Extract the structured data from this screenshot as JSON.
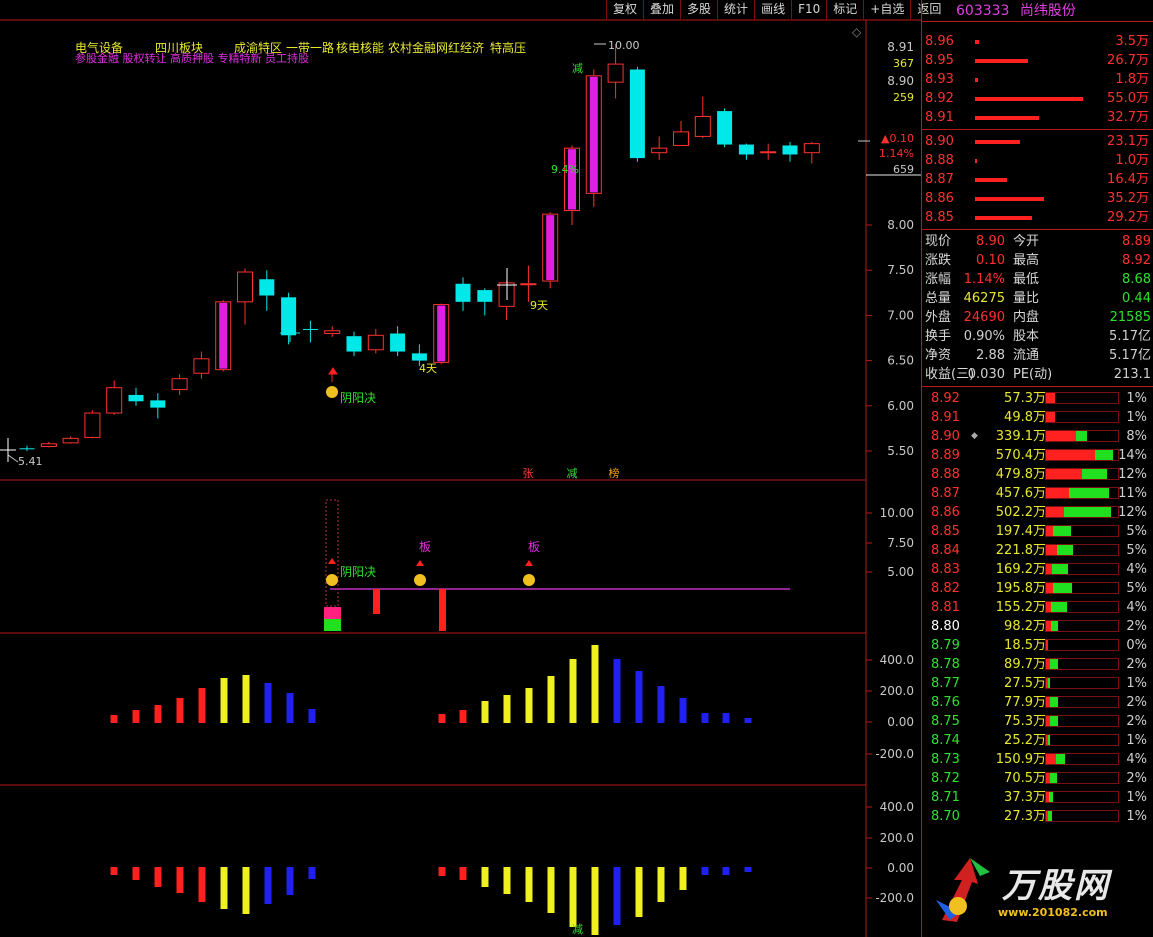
{
  "toolbar": {
    "buttons": [
      "复权",
      "叠加",
      "多股",
      "统计",
      "画线",
      "F10",
      "标记",
      "+自选",
      "返回"
    ]
  },
  "stock": {
    "code": "603333",
    "name": "尚纬股份"
  },
  "main_chart": {
    "concepts_line1": [
      "电气设备",
      "四川板块",
      "成渝特区",
      "一带一路",
      "核电核能",
      "农村金融",
      "网红经济",
      "特高压"
    ],
    "concepts_line2": "参股金融 股权转让 高质押股 专精特新 员工持股",
    "high_label": "10.00",
    "low_label": "5.41",
    "y_ticks": [
      "8.00",
      "7.50",
      "7.00",
      "6.50",
      "6.00",
      "5.50"
    ],
    "right_info": {
      "p1": "8.91",
      "v1": "367",
      "p2": "8.90",
      "v2": "259",
      "chg": "▲0.10",
      "pct": "1.14%",
      "vol": "659"
    },
    "annotations": {
      "jian": "减",
      "pct94": "9.4%",
      "tian9": "9天",
      "tian4": "4天",
      "yinyang": "阴阳决"
    },
    "markers": [
      "张",
      "减",
      "榜"
    ]
  },
  "panel2": {
    "y_ticks": [
      "10.00",
      "7.50",
      "5.00"
    ],
    "ban": "板",
    "yinyang": "阴阳决"
  },
  "panel3": {
    "y_ticks": [
      "400.0",
      "200.0",
      "0.00",
      "-200.0"
    ]
  },
  "panel4": {
    "y_ticks": [
      "400.0",
      "200.0",
      "0.00",
      "-200.0"
    ],
    "jian": "减"
  },
  "order_book": {
    "asks": [
      {
        "price": "8.96",
        "vol": "3.5万",
        "bar": 0.04
      },
      {
        "price": "8.95",
        "vol": "26.7万",
        "bar": 0.49
      },
      {
        "price": "8.93",
        "vol": "1.8万",
        "bar": 0.03
      },
      {
        "price": "8.92",
        "vol": "55.0万",
        "bar": 1.0
      },
      {
        "price": "8.91",
        "vol": "32.7万",
        "bar": 0.59
      }
    ],
    "bids": [
      {
        "price": "8.90",
        "vol": "23.1万",
        "bar": 0.42
      },
      {
        "price": "8.88",
        "vol": "1.0万",
        "bar": 0.02
      },
      {
        "price": "8.87",
        "vol": "16.4万",
        "bar": 0.3
      },
      {
        "price": "8.86",
        "vol": "35.2万",
        "bar": 0.64
      },
      {
        "price": "8.85",
        "vol": "29.2万",
        "bar": 0.53
      }
    ]
  },
  "stats": [
    {
      "l1": "现价",
      "v1": "8.90",
      "c1": "#ff3030",
      "l2": "今开",
      "v2": "8.89",
      "c2": "#ff3030"
    },
    {
      "l1": "涨跌",
      "v1": "0.10",
      "c1": "#ff3030",
      "l2": "最高",
      "v2": "8.92",
      "c2": "#ff3030"
    },
    {
      "l1": "涨幅",
      "v1": "1.14%",
      "c1": "#ff3030",
      "l2": "最低",
      "v2": "8.68",
      "c2": "#30e030"
    },
    {
      "l1": "总量",
      "v1": "46275",
      "c1": "#e8e830",
      "l2": "量比",
      "v2": "0.44",
      "c2": "#30e030"
    },
    {
      "l1": "外盘",
      "v1": "24690",
      "c1": "#ff3030",
      "l2": "内盘",
      "v2": "21585",
      "c2": "#30e030"
    },
    {
      "l1": "换手",
      "v1": "0.90%",
      "c1": "#d0d0d0",
      "l2": "股本",
      "v2": "5.17亿",
      "c2": "#d0d0d0"
    },
    {
      "l1": "净资",
      "v1": "2.88",
      "c1": "#d0d0d0",
      "l2": "流通",
      "v2": "5.17亿",
      "c2": "#d0d0d0"
    },
    {
      "l1": "收益(三)",
      "v1": "0.030",
      "c1": "#d0d0d0",
      "l2": "PE(动)",
      "v2": "213.1",
      "c2": "#d0d0d0"
    }
  ],
  "volume_by_price": [
    {
      "price": "8.92",
      "vol": "57.3万",
      "pct": "1%",
      "r": 0.13,
      "g": 0
    },
    {
      "price": "8.91",
      "vol": "49.8万",
      "pct": "1%",
      "r": 0.12,
      "g": 0
    },
    {
      "price": "8.90",
      "vol": "339.1万",
      "pct": "8%",
      "r": 0.42,
      "g": 0.15,
      "mark": "◆"
    },
    {
      "price": "8.89",
      "vol": "570.4万",
      "pct": "14%",
      "r": 0.68,
      "g": 0.25
    },
    {
      "price": "8.88",
      "vol": "479.8万",
      "pct": "12%",
      "r": 0.5,
      "g": 0.35
    },
    {
      "price": "8.87",
      "vol": "457.6万",
      "pct": "11%",
      "r": 0.32,
      "g": 0.55
    },
    {
      "price": "8.86",
      "vol": "502.2万",
      "pct": "12%",
      "r": 0.25,
      "g": 0.65
    },
    {
      "price": "8.85",
      "vol": "197.4万",
      "pct": "5%",
      "r": 0.1,
      "g": 0.25
    },
    {
      "price": "8.84",
      "vol": "221.8万",
      "pct": "5%",
      "r": 0.15,
      "g": 0.22
    },
    {
      "price": "8.83",
      "vol": "169.2万",
      "pct": "4%",
      "r": 0.08,
      "g": 0.22
    },
    {
      "price": "8.82",
      "vol": "195.8万",
      "pct": "5%",
      "r": 0.1,
      "g": 0.26
    },
    {
      "price": "8.81",
      "vol": "155.2万",
      "pct": "4%",
      "r": 0.07,
      "g": 0.22
    },
    {
      "price": "8.80",
      "vol": "98.2万",
      "pct": "2%",
      "r": 0.07,
      "g": 0.1
    },
    {
      "price": "8.79",
      "vol": "18.5万",
      "pct": "0%",
      "r": 0.03,
      "g": 0
    },
    {
      "price": "8.78",
      "vol": "89.7万",
      "pct": "2%",
      "r": 0.06,
      "g": 0.1
    },
    {
      "price": "8.77",
      "vol": "27.5万",
      "pct": "1%",
      "r": 0.03,
      "g": 0.03
    },
    {
      "price": "8.76",
      "vol": "77.9万",
      "pct": "2%",
      "r": 0.06,
      "g": 0.1
    },
    {
      "price": "8.75",
      "vol": "75.3万",
      "pct": "2%",
      "r": 0.06,
      "g": 0.1
    },
    {
      "price": "8.74",
      "vol": "25.2万",
      "pct": "1%",
      "r": 0.03,
      "g": 0.03
    },
    {
      "price": "8.73",
      "vol": "150.9万",
      "pct": "4%",
      "r": 0.14,
      "g": 0.12
    },
    {
      "price": "8.72",
      "vol": "70.5万",
      "pct": "2%",
      "r": 0.05,
      "g": 0.1
    },
    {
      "price": "8.71",
      "vol": "37.3万",
      "pct": "1%",
      "r": 0.04,
      "g": 0.06
    },
    {
      "price": "8.70",
      "vol": "27.3万",
      "pct": "1%",
      "r": 0.03,
      "g": 0.05
    }
  ],
  "logo": {
    "text": "万股网",
    "url": "www.201082.com"
  },
  "candles": [
    [
      5.53,
      5.52,
      5.56,
      5.5
    ],
    [
      5.55,
      5.58,
      5.6,
      5.54
    ],
    [
      5.59,
      5.64,
      5.66,
      5.58
    ],
    [
      5.65,
      5.92,
      5.95,
      5.64
    ],
    [
      5.92,
      6.2,
      6.28,
      5.9
    ],
    [
      6.12,
      6.05,
      6.2,
      6.0
    ],
    [
      6.06,
      5.98,
      6.14,
      5.86
    ],
    [
      6.18,
      6.3,
      6.35,
      6.12
    ],
    [
      6.36,
      6.52,
      6.6,
      6.3
    ],
    [
      6.4,
      7.15,
      7.17,
      6.38
    ],
    [
      7.15,
      7.48,
      7.52,
      6.9
    ],
    [
      7.4,
      7.22,
      7.5,
      7.05
    ],
    [
      7.2,
      6.78,
      7.25,
      6.68
    ],
    [
      6.85,
      6.84,
      6.94,
      6.7
    ],
    [
      6.8,
      6.83,
      6.88,
      6.76
    ],
    [
      6.77,
      6.6,
      6.82,
      6.55
    ],
    [
      6.62,
      6.78,
      6.85,
      6.58
    ],
    [
      6.8,
      6.6,
      6.88,
      6.55
    ],
    [
      6.58,
      6.5,
      6.68,
      6.44
    ],
    [
      6.48,
      7.12,
      7.13,
      6.46
    ],
    [
      7.35,
      7.15,
      7.42,
      7.05
    ],
    [
      7.28,
      7.15,
      7.3,
      7.0
    ],
    [
      7.1,
      7.36,
      7.38,
      6.95
    ],
    [
      7.35,
      7.35,
      7.55,
      7.15
    ],
    [
      7.38,
      8.12,
      8.14,
      7.3
    ],
    [
      8.16,
      8.85,
      8.88,
      8.0
    ],
    [
      8.35,
      9.65,
      9.72,
      8.2
    ],
    [
      9.58,
      9.78,
      10.0,
      9.4
    ],
    [
      9.72,
      8.74,
      9.75,
      8.7
    ],
    [
      8.8,
      8.85,
      8.98,
      8.72
    ],
    [
      8.88,
      9.03,
      9.15,
      8.88
    ],
    [
      8.98,
      9.2,
      9.42,
      8.96
    ],
    [
      9.26,
      8.89,
      9.29,
      8.86
    ],
    [
      8.89,
      8.78,
      8.9,
      8.72
    ],
    [
      8.8,
      8.81,
      8.9,
      8.72
    ],
    [
      8.88,
      8.78,
      8.92,
      8.7
    ],
    [
      8.8,
      8.9,
      8.92,
      8.68
    ]
  ]
}
